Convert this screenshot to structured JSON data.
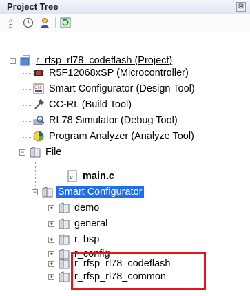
{
  "panel": {
    "title": "Project Tree",
    "close_glyph": "⊠"
  },
  "toolbar": {
    "buttons": [
      {
        "icon": "sort-icon"
      },
      {
        "icon": "clock-icon"
      },
      {
        "icon": "user-icon"
      },
      {
        "icon": "refresh-icon"
      }
    ]
  },
  "tree": {
    "project": "r_rfsp_rl78_codeflash (Project)",
    "microcontroller": "R5F12068xSP (Microcontroller)",
    "smart_configurator_tool": "Smart Configurator (Design Tool)",
    "build_tool": "CC-RL (Build Tool)",
    "debug_tool": "RL78 Simulator (Debug Tool)",
    "analyze_tool": "Program Analyzer (Analyze Tool)",
    "file_folder": "File",
    "main_file": "main.c",
    "sc_folder": "Smart Configurator",
    "folders": {
      "demo": "demo",
      "general": "general",
      "r_bsp": "r_bsp",
      "r_config": "r_config",
      "codeflash": "r_rfsp_rl78_codeflash",
      "common": "r_rfsp_rl78_common"
    }
  },
  "colors": {
    "selection": "#1e6ff0",
    "highlight_box": "#e8131d"
  }
}
